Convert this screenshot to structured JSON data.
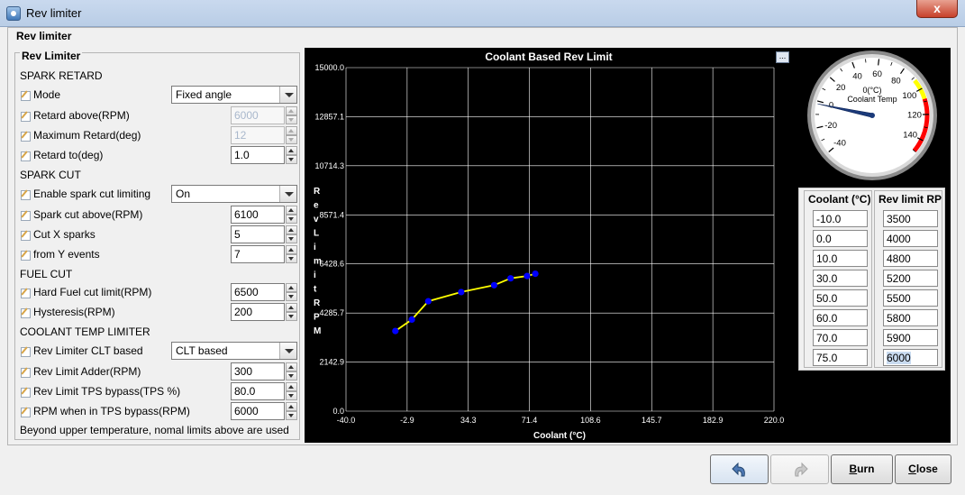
{
  "window": {
    "title": "Rev limiter",
    "close_glyph": "x"
  },
  "outer_group": {
    "legend": "Rev limiter"
  },
  "left_group": {
    "legend": "Rev Limiter"
  },
  "sections": {
    "spark_retard": "SPARK RETARD",
    "spark_cut": "SPARK CUT",
    "fuel_cut": "FUEL CUT",
    "coolant": "COOLANT TEMP LIMITER"
  },
  "fields": {
    "mode": {
      "label": "Mode",
      "value": "Fixed angle"
    },
    "retard_above": {
      "label": "Retard above(RPM)",
      "value": "6000"
    },
    "max_retard": {
      "label": "Maximum Retard(deg)",
      "value": "12"
    },
    "retard_to": {
      "label": "Retard to(deg)",
      "value": "1.0"
    },
    "enable_spark_cut": {
      "label": "Enable spark cut limiting",
      "value": "On"
    },
    "spark_cut_above": {
      "label": "Spark cut above(RPM)",
      "value": "6100"
    },
    "cut_x_sparks": {
      "label": "Cut X sparks",
      "value": "5"
    },
    "from_y_events": {
      "label": "from Y events",
      "value": "7"
    },
    "hard_fuel_cut": {
      "label": "Hard Fuel cut limit(RPM)",
      "value": "6500"
    },
    "hysteresis": {
      "label": "Hysteresis(RPM)",
      "value": "200"
    },
    "clt_based": {
      "label": "Rev Limiter CLT based",
      "value": "CLT based"
    },
    "limit_adder": {
      "label": "Rev Limit Adder(RPM)",
      "value": "300"
    },
    "tps_bypass": {
      "label": "Rev Limit TPS bypass(TPS %)",
      "value": "80.0"
    },
    "rpm_tps_bypass": {
      "label": "RPM when in TPS bypass(RPM)",
      "value": "6000"
    }
  },
  "footnote": "Beyond upper temperature, nomal limits above are used",
  "chart_menu": "...",
  "chart_data": {
    "type": "line",
    "title": "Coolant Based Rev Limit",
    "xlabel": "Coolant (°C)",
    "ylabel": "Rev Limit RPM",
    "xlim": [
      -40.0,
      220.0
    ],
    "ylim": [
      0.0,
      15000.0
    ],
    "x_ticks": [
      "-40.0",
      "-2.9",
      "34.3",
      "71.4",
      "108.6",
      "145.7",
      "182.9",
      "220.0"
    ],
    "y_ticks": [
      "0.0",
      "2142.9",
      "4285.7",
      "6428.6",
      "8571.4",
      "10714.3",
      "12857.1",
      "15000.0"
    ],
    "x": [
      -10.0,
      0.0,
      10.0,
      30.0,
      50.0,
      60.0,
      70.0,
      75.0
    ],
    "y": [
      3500,
      4000,
      4800,
      5200,
      5500,
      5800,
      5900,
      6000
    ],
    "grid": true,
    "colors": {
      "line": "#ffff00",
      "point": "#0000ff",
      "grid": "#ffffff",
      "background": "#000000"
    }
  },
  "gauge": {
    "label": "Coolant Temp",
    "value_text": "0(°C)",
    "value": -2,
    "min": -40,
    "max": 150,
    "ticks": [
      "-40",
      "-20",
      "0",
      "20",
      "40",
      "60",
      "80",
      "100",
      "120",
      "140"
    ],
    "warn_color": "#ffff00",
    "danger_color": "#ff0000"
  },
  "table": {
    "col1_header": "Coolant (°C)",
    "col2_header": "Rev limit RP",
    "coolant": [
      "-10.0",
      "0.0",
      "10.0",
      "30.0",
      "50.0",
      "60.0",
      "70.0",
      "75.0"
    ],
    "rpm": [
      "3500",
      "4000",
      "4800",
      "5200",
      "5500",
      "5800",
      "5900",
      "6000"
    ]
  },
  "buttons": {
    "undo_icon": "undo-arrow-icon",
    "redo_icon": "redo-arrow-icon",
    "burn_u": "B",
    "burn_rest": "urn",
    "close_u": "C",
    "close_rest": "lose"
  }
}
